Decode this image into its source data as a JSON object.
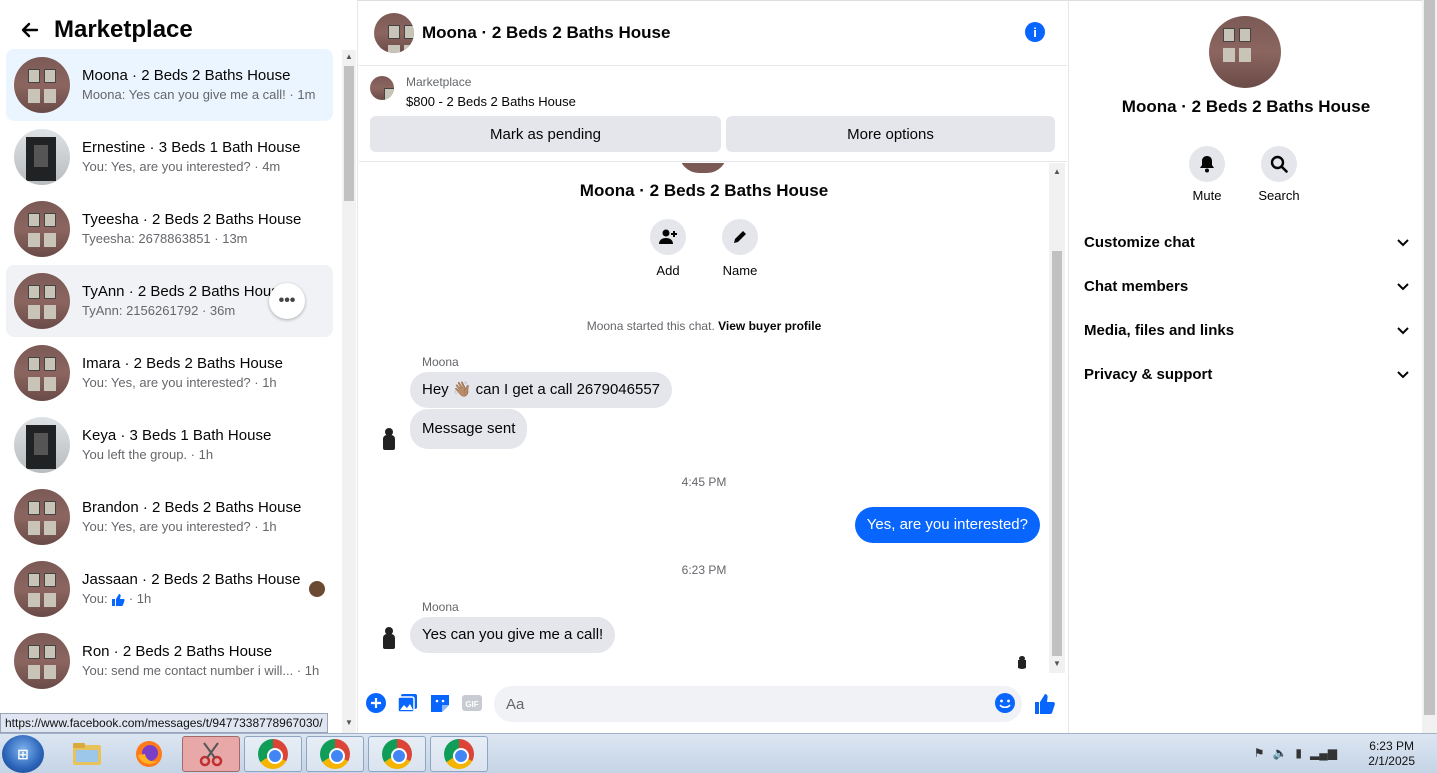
{
  "sidebar": {
    "title": "Marketplace",
    "conversations": [
      {
        "name": "Moona · 2 Beds 2 Baths House",
        "sub": "Moona: Yes can you give me a call! · 1m"
      },
      {
        "name": "Ernestine · 3 Beds 1 Bath House",
        "sub": "You: Yes, are you interested? · 4m"
      },
      {
        "name": "Tyeesha · 2 Beds 2 Baths House",
        "sub": "Tyeesha: 2678863851 · 13m"
      },
      {
        "name": "TyAnn · 2 Beds 2 Baths House",
        "sub": "TyAnn: 2156261792 · 36m"
      },
      {
        "name": "Imara · 2 Beds 2 Baths House",
        "sub": "You: Yes, are you interested? · 1h"
      },
      {
        "name": "Keya · 3 Beds 1 Bath House",
        "sub": "You left the group. · 1h"
      },
      {
        "name": "Brandon · 2 Beds 2 Baths House",
        "sub": "You: Yes, are you interested? · 1h"
      },
      {
        "name": "Jassaan · 2 Beds 2 Baths House",
        "sub_prefix": "You:",
        "sub_suffix": "· 1h"
      },
      {
        "name": "Ron · 2 Beds 2 Baths House",
        "sub": "You: send me contact number i will... · 1h"
      }
    ],
    "status_url": "https://www.facebook.com/messages/t/9477338778967030/"
  },
  "chat": {
    "header_name": "Moona · 2 Beds 2 Baths House",
    "listing_label": "Marketplace",
    "listing_price": "$800 - 2 Beds 2 Baths House",
    "mark_pending_label": "Mark as pending",
    "more_options_label": "More options",
    "convo_title": "Moona · 2 Beds 2 Baths House",
    "add_label": "Add",
    "name_label": "Name",
    "system_text": "Moona started this chat.",
    "view_profile": "View buyer profile",
    "sender1": "Moona",
    "msg1": "Hey 👋🏽 can I get a call 2679046557",
    "msg2": "Message sent",
    "time1": "4:45 PM",
    "msg3": "Yes, are you interested?",
    "time2": "6:23 PM",
    "sender2": "Moona",
    "msg4": "Yes can you give me a call!",
    "input_placeholder": "Aa"
  },
  "rpanel": {
    "name": "Moona · 2 Beds 2 Baths House",
    "mute_label": "Mute",
    "search_label": "Search",
    "rows": [
      "Customize chat",
      "Chat members",
      "Media, files and links",
      "Privacy & support"
    ]
  },
  "taskbar": {
    "time": "6:23 PM",
    "date": "2/1/2025"
  },
  "colors": {
    "accent": "#0866ff",
    "active_row": "#ebf5ff",
    "bubble_gray": "#e4e6eb"
  }
}
